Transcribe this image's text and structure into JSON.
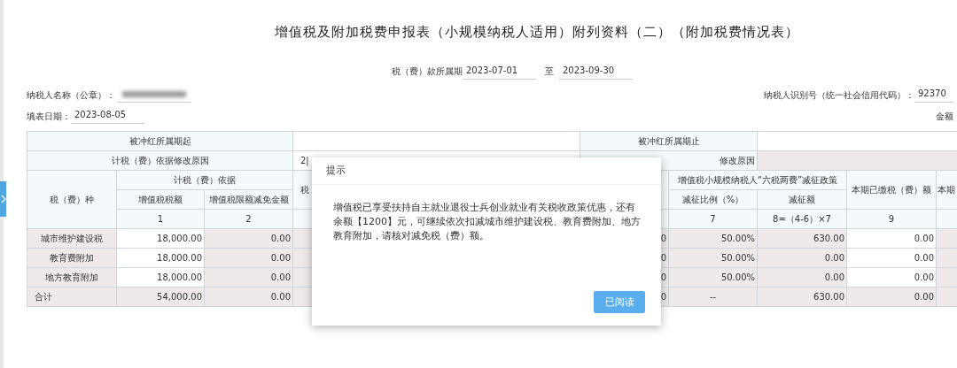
{
  "title": "增值税及附加税费申报表（小规模纳税人适用）附列资料（二）（附加税费情况表）",
  "period": {
    "label": "税（费）款所属期",
    "start": "2023-07-01",
    "separator": "至",
    "end": "2023-09-30"
  },
  "taxpayer_name": {
    "label": "纳税人名称（公章）：",
    "redacted": true
  },
  "taxpayer_id": {
    "label": "纳税人识别号（统一社会信用代码）：",
    "value": "92370"
  },
  "fill_date": {
    "label": "填表日期：",
    "value": "2023-08-05"
  },
  "amount_unit": "金额",
  "sidebar_toggle": {
    "expanded": false
  },
  "table": {
    "rows": [
      [
        {
          "kind": "head",
          "text": "被冲红所属期起",
          "colspan": 3
        },
        {
          "kind": "blank",
          "colspan": 3
        },
        {
          "kind": "head",
          "text": "被冲红所属期止",
          "colspan": 2
        },
        {
          "kind": "blank",
          "colspan": 3
        }
      ],
      [
        {
          "kind": "head",
          "text": "计税（费）依据修改原因",
          "colspan": 3
        },
        {
          "kind": "white_left",
          "text": "2|",
          "colspan": 3
        },
        {
          "kind": "head_right",
          "text": "修改原因",
          "colspan": 2
        },
        {
          "kind": "grey_blank",
          "colspan": 3
        }
      ],
      [
        {
          "kind": "head",
          "text": "税（费）种",
          "rowspan": 3
        },
        {
          "kind": "head",
          "text": "计税（费）依据",
          "colspan": 2
        },
        {
          "kind": "head_left",
          "text": "税",
          "rowspan": 2
        },
        {
          "kind": "head_blank",
          "rowspan": 2
        },
        {
          "kind": "head_blank",
          "rowspan": 2
        },
        {
          "kind": "head_blank",
          "rowspan": 2
        },
        {
          "kind": "head",
          "text": "增值税小规模纳税人“六税两费”减征政策",
          "colspan": 2
        },
        {
          "kind": "head",
          "text": "本期已缴税（费）额",
          "rowspan": 2
        },
        {
          "kind": "head_tight",
          "text": "本期",
          "rowspan": 2
        }
      ],
      [
        {
          "kind": "head",
          "text": "增值税税额"
        },
        {
          "kind": "head",
          "text": "增值税限额减免金额"
        },
        {
          "kind": "head",
          "text": "减征比例（%）"
        },
        {
          "kind": "head",
          "text": "减征额"
        }
      ],
      [
        {
          "kind": "head",
          "text": "1"
        },
        {
          "kind": "head",
          "text": "2"
        },
        {
          "kind": "head_blank"
        },
        {
          "kind": "head_blank"
        },
        {
          "kind": "head_blank"
        },
        {
          "kind": "head_blank"
        },
        {
          "kind": "head",
          "text": "7"
        },
        {
          "kind": "head",
          "text": "8=（4-6）×7"
        },
        {
          "kind": "head",
          "text": "9"
        },
        {
          "kind": "head_blank"
        }
      ],
      [
        {
          "kind": "name",
          "text": "城市维护建设税"
        },
        {
          "kind": "num",
          "text": "18,000.00"
        },
        {
          "kind": "num_grey",
          "text": "0.00"
        },
        {
          "kind": "grey_blank"
        },
        {
          "kind": "grey_blank"
        },
        {
          "kind": "grey_blank"
        },
        {
          "kind": "num_grey",
          "text": "0"
        },
        {
          "kind": "num_grey",
          "text": "50.00%"
        },
        {
          "kind": "num_grey",
          "text": "630.00"
        },
        {
          "kind": "num",
          "text": "0.00"
        },
        {
          "kind": "grey_blank"
        }
      ],
      [
        {
          "kind": "name",
          "text": "教育费附加"
        },
        {
          "kind": "num",
          "text": "18,000.00"
        },
        {
          "kind": "num_grey",
          "text": "0.00"
        },
        {
          "kind": "grey_blank"
        },
        {
          "kind": "grey_blank"
        },
        {
          "kind": "grey_blank"
        },
        {
          "kind": "num_grey",
          "text": "0"
        },
        {
          "kind": "num_grey",
          "text": "50.00%"
        },
        {
          "kind": "num_grey",
          "text": "0.00"
        },
        {
          "kind": "num",
          "text": "0.00"
        },
        {
          "kind": "grey_blank"
        }
      ],
      [
        {
          "kind": "name",
          "text": "地方教育附加"
        },
        {
          "kind": "num",
          "text": "18,000.00"
        },
        {
          "kind": "num_grey",
          "text": "0.00"
        },
        {
          "kind": "grey_blank"
        },
        {
          "kind": "grey_blank"
        },
        {
          "kind": "grey_blank"
        },
        {
          "kind": "num_grey",
          "text": "0"
        },
        {
          "kind": "num_grey",
          "text": "50.00%"
        },
        {
          "kind": "num_grey",
          "text": "0.00"
        },
        {
          "kind": "num",
          "text": "0.00"
        },
        {
          "kind": "grey_blank"
        }
      ],
      [
        {
          "kind": "total",
          "text": "合计"
        },
        {
          "kind": "num_grey",
          "text": "54,000.00"
        },
        {
          "kind": "num_grey",
          "text": "0.00"
        },
        {
          "kind": "grey_blank"
        },
        {
          "kind": "grey_blank"
        },
        {
          "kind": "grey_blank"
        },
        {
          "kind": "num_grey",
          "text": "0"
        },
        {
          "kind": "grey_center",
          "text": "--"
        },
        {
          "kind": "num_grey",
          "text": "630.00"
        },
        {
          "kind": "num_grey",
          "text": "0.00"
        },
        {
          "kind": "grey_blank"
        }
      ]
    ]
  },
  "dialog": {
    "title": "提示",
    "message": "增值税已享受扶持自主就业退役士兵创业就业有关税收政策优惠，还有余额【1200】元，可继续依次扣减城市维护建设税、教育费附加、地方教育附加，请核对减免税（费）额。",
    "button": "已阅读"
  }
}
